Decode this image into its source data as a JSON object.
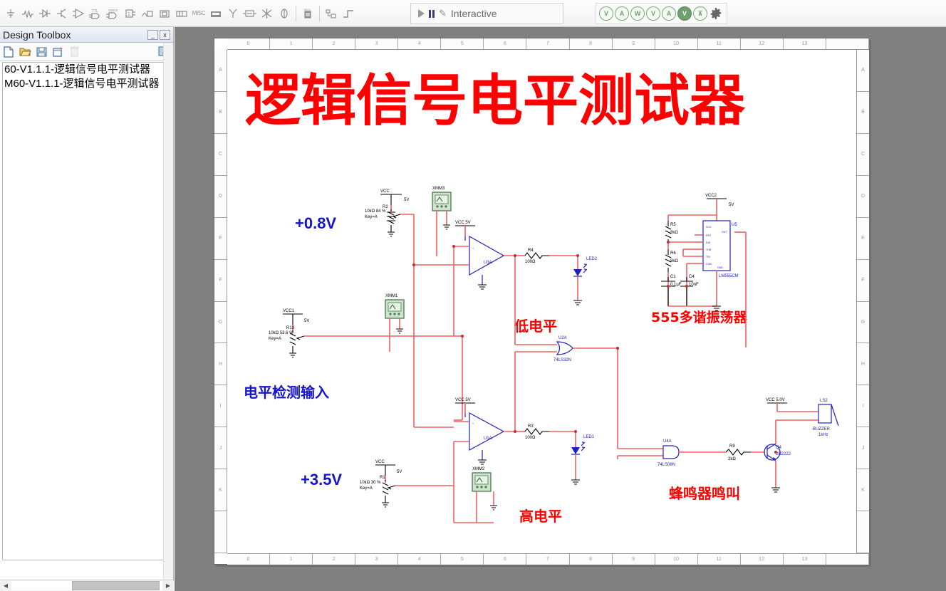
{
  "window": {
    "sim_control": {
      "run_label": "run-icon",
      "pause_label": "pause-icon",
      "mode": "Interactive"
    },
    "probes": [
      "V",
      "A",
      "W",
      "V",
      "A",
      "V",
      "JL"
    ]
  },
  "design_toolbox": {
    "title": "Design Toolbox",
    "minimize_label": "_",
    "close_label": "x",
    "toolbar_icons": [
      "new-sheet-icon",
      "open-folder-icon",
      "save-icon",
      "new-window-icon",
      "delete-icon",
      "history-icon"
    ],
    "tree": [
      {
        "label": "60-V1.1.1-逻辑信号电平测试器"
      },
      {
        "label": "M60-V1.1.1-逻辑信号电平测试器"
      }
    ]
  },
  "sheet": {
    "ruler_h": [
      "0",
      "1",
      "2",
      "3",
      "4",
      "5",
      "6",
      "7",
      "8",
      "9",
      "10",
      "11",
      "12",
      "13",
      ""
    ],
    "ruler_v": [
      "A",
      "B",
      "C",
      "D",
      "E",
      "F",
      "G",
      "H",
      "I",
      "J",
      "K",
      ""
    ],
    "title": "逻辑信号电平测试器"
  },
  "annotations": {
    "v_low": "+0.8V",
    "v_high": "+3.5V",
    "input_label": "电平检测输入",
    "low_level": "低电平",
    "high_level": "高电平",
    "oscillator": "555多谐振荡器",
    "buzzer_sound": "蜂鸣器鸣叫"
  },
  "circuit": {
    "power": {
      "vcc_top": "VCC",
      "vcc_top_v": "5V",
      "vcc_u3a": "VCC  5V",
      "vcc1": "VCC1",
      "vcc1_v": "5V",
      "vcc_u1a": "VCC  5V",
      "vcc_bottom": "VCC",
      "vcc_bottom_v": "5V",
      "vcc2": "VCC2",
      "vcc2_v": "5V",
      "vcc_buzzer": "VCC  5.0V"
    },
    "components": [
      {
        "ref": "R2",
        "value": "10kΩ  84 %",
        "key": "Key=A"
      },
      {
        "ref": "R13",
        "value": "10kΩ 53.6 %",
        "key": "Key=A"
      },
      {
        "ref": "R1",
        "value": "10kΩ  30 %",
        "key": "Key=A"
      },
      {
        "ref": "R4",
        "value": "100Ω",
        "key": ""
      },
      {
        "ref": "R3",
        "value": "100Ω",
        "key": ""
      },
      {
        "ref": "R5",
        "value": "2kΩ",
        "key": ""
      },
      {
        "ref": "R6",
        "value": "8kΩ",
        "key": ""
      },
      {
        "ref": "R9",
        "value": "2kΩ",
        "key": ""
      },
      {
        "ref": "C1",
        "value": "0.1µF",
        "key": ""
      },
      {
        "ref": "C4",
        "value": "10nF",
        "key": ""
      },
      {
        "ref": "U5",
        "value": "LM555CM",
        "key": ""
      },
      {
        "ref": "U1A",
        "value": "",
        "key": ""
      },
      {
        "ref": "U3A",
        "value": "",
        "key": ""
      },
      {
        "ref": "U2A",
        "value": "74LS32N",
        "key": ""
      },
      {
        "ref": "U4A",
        "value": "74LS08N",
        "key": ""
      },
      {
        "ref": "Q4",
        "value": "2N2222",
        "key": ""
      },
      {
        "ref": "LS2",
        "value": "BUZZER",
        "key": "1kHz"
      },
      {
        "ref": "LED1",
        "value": "",
        "key": ""
      },
      {
        "ref": "LED2",
        "value": "",
        "key": ""
      },
      {
        "ref": "XMM1",
        "value": "",
        "key": ""
      },
      {
        "ref": "XMM2",
        "value": "",
        "key": ""
      },
      {
        "ref": "XMM3",
        "value": "",
        "key": ""
      }
    ],
    "ic_pins_555": [
      "VCC",
      "RST",
      "DIS",
      "THR",
      "TRI",
      "CON",
      "GND",
      "OUT"
    ]
  },
  "colors": {
    "wire": "#f06060",
    "component": "#2020c0",
    "title_red": "#ff0000",
    "label_blue": "#1414cd",
    "panel_header_from": "#f3f6fa",
    "workspace_bg": "#808080"
  }
}
